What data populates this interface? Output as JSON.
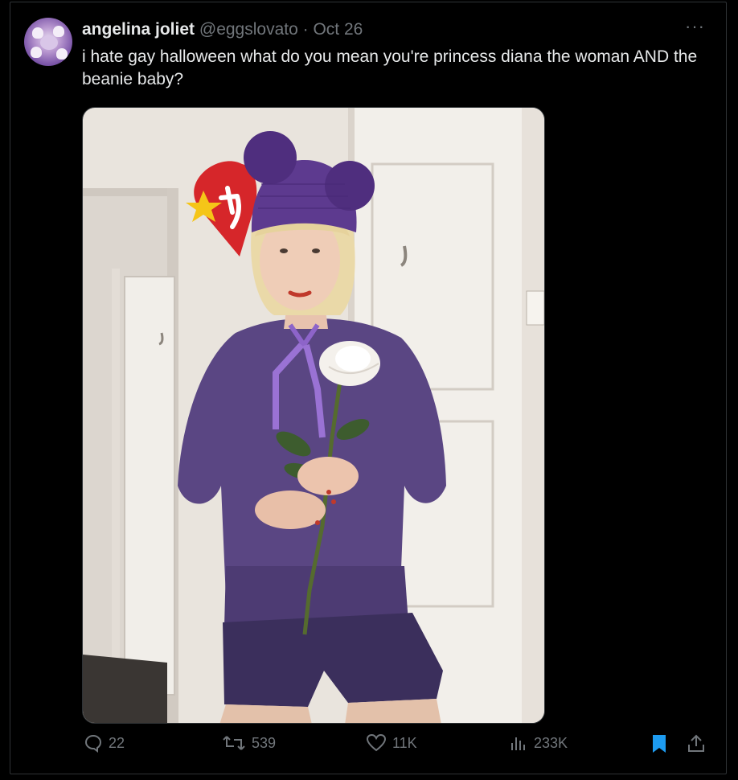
{
  "tweet": {
    "author_name": "angelina joliet",
    "handle": "@eggslovato",
    "separator": "·",
    "date": "Oct 26",
    "more_icon": "more-icon",
    "text": "i hate gay halloween what do you mean you're princess diana the woman AND the beanie baby?"
  },
  "actions": {
    "replies": "22",
    "retweets": "539",
    "likes": "11K",
    "views": "233K"
  },
  "colors": {
    "background": "#000000",
    "text": "#e7e9ea",
    "muted": "#71767b",
    "bookmark_active": "#1d9bf0"
  }
}
